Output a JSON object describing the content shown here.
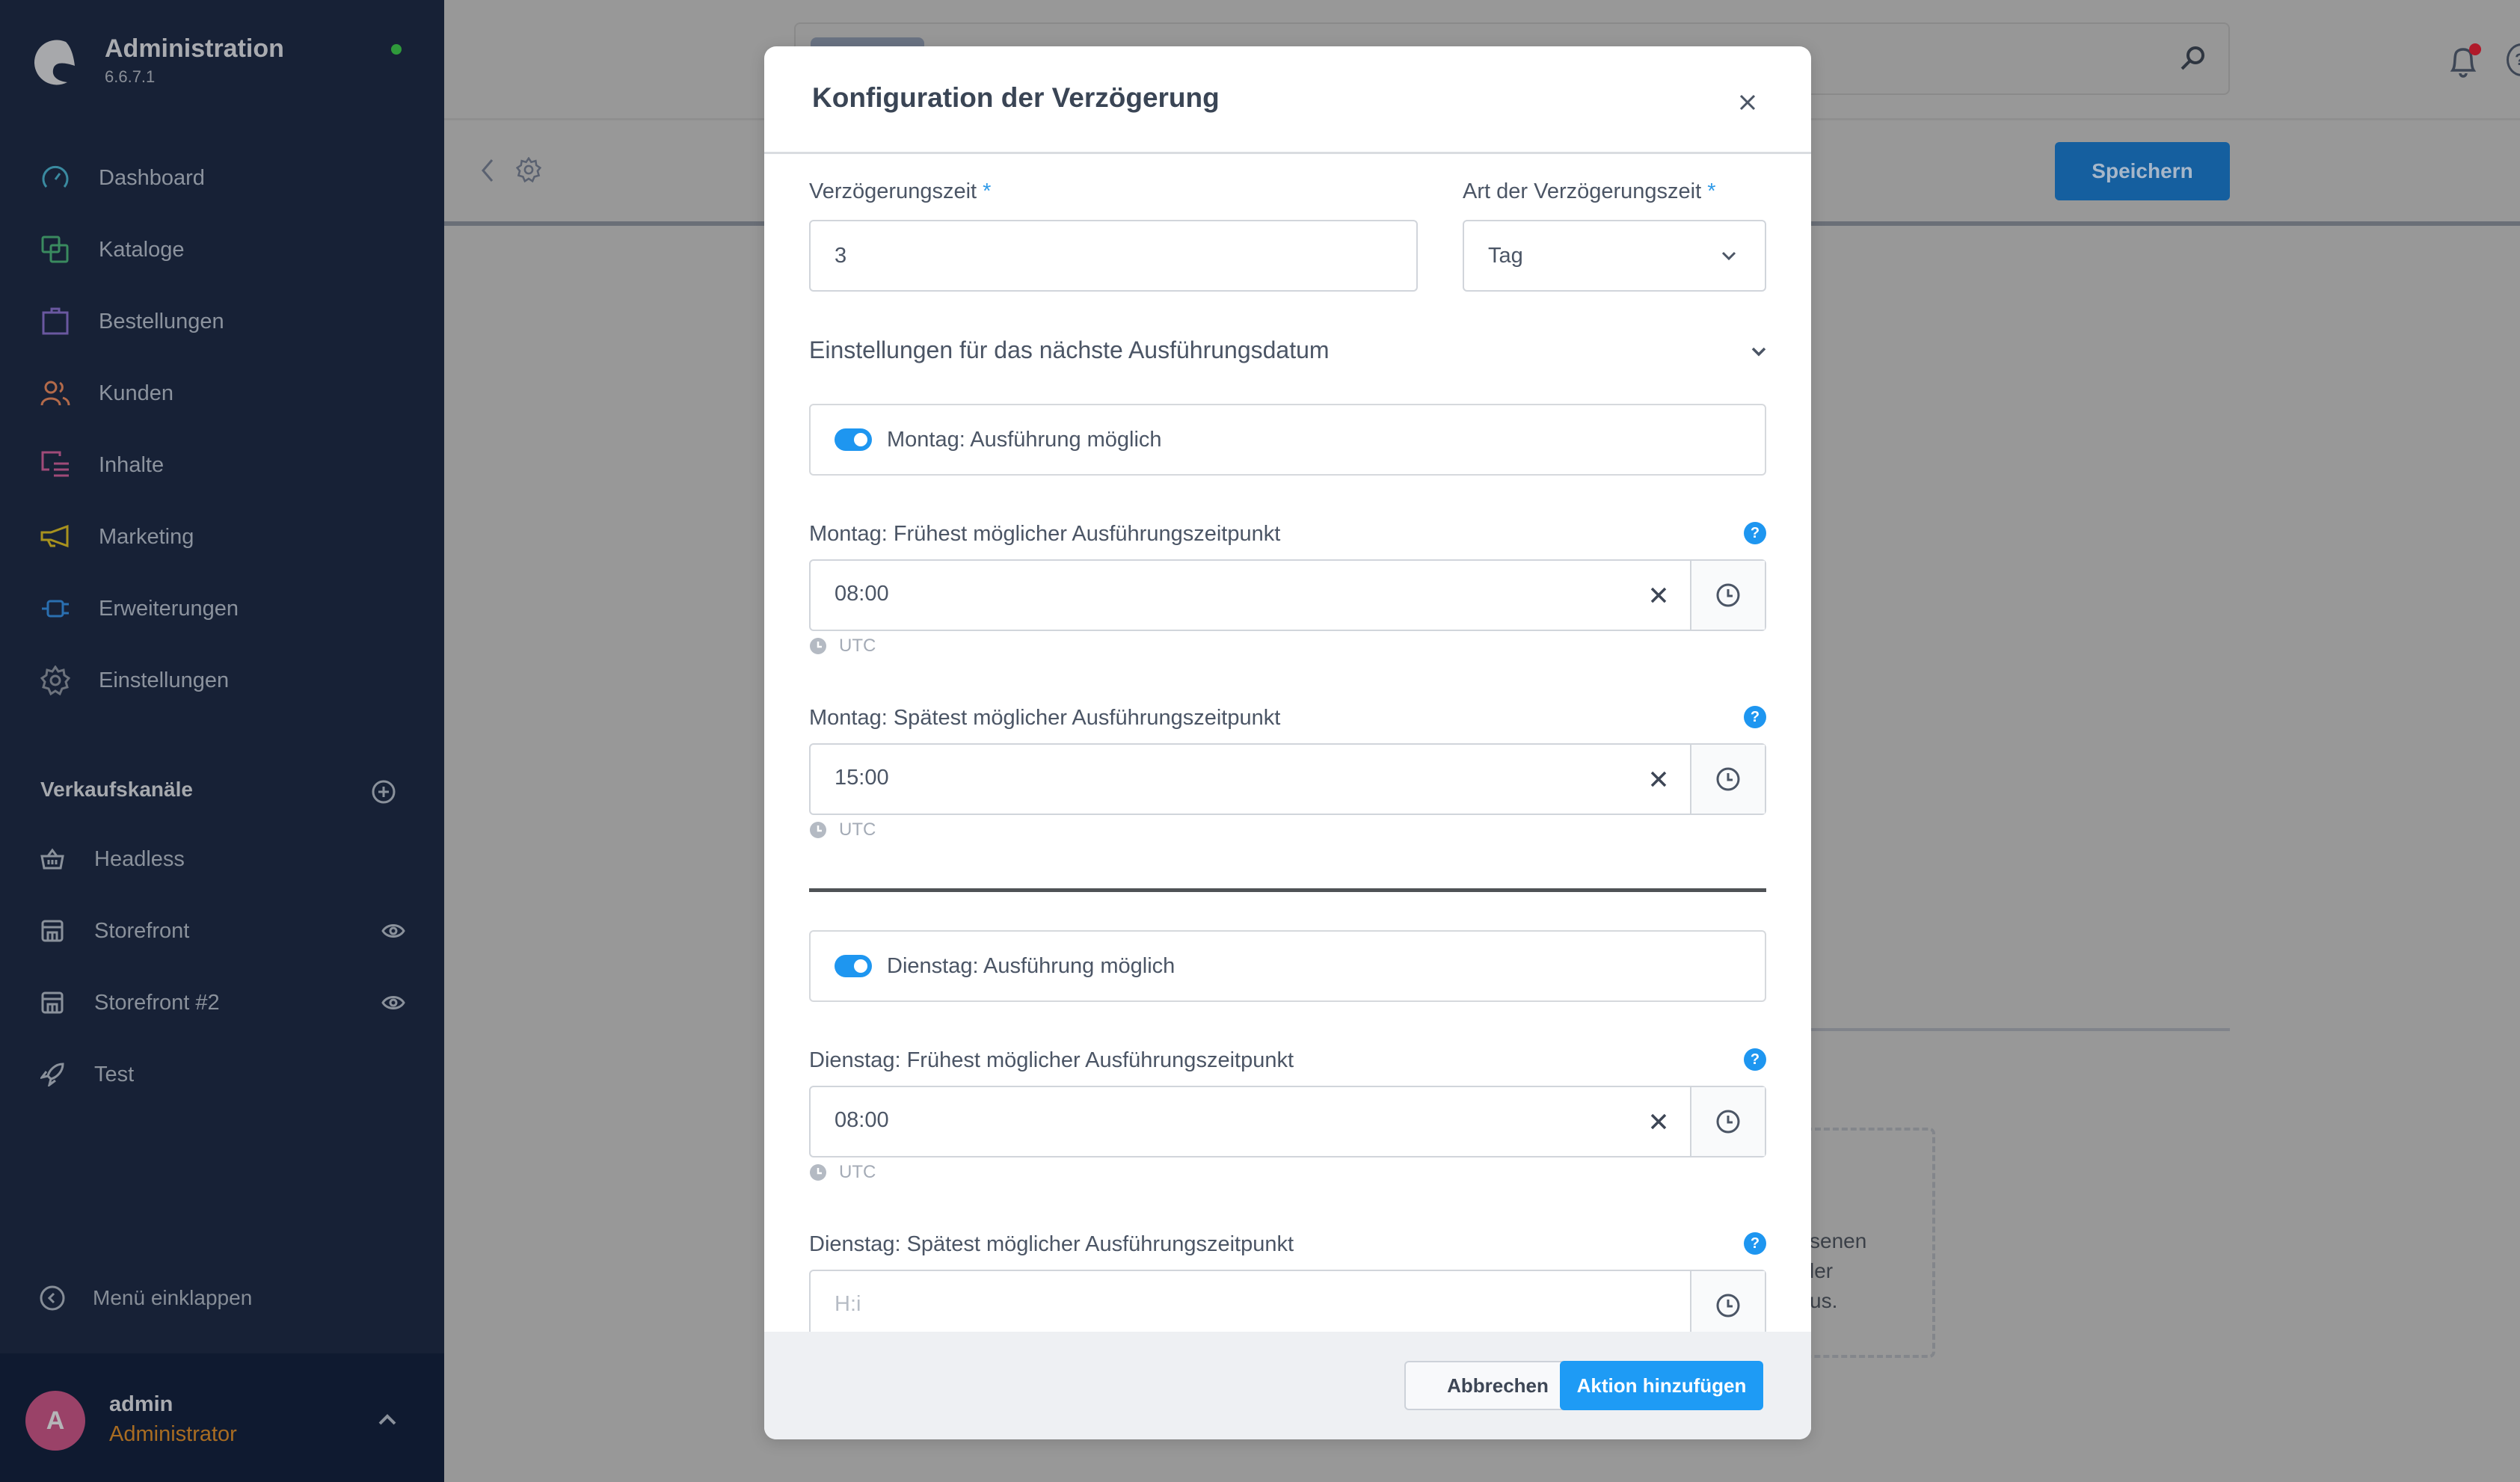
{
  "app": {
    "title": "Administration",
    "version": "6.6.7.1"
  },
  "sidebar": {
    "items": [
      {
        "label": "Dashboard",
        "icon": "dashboard-icon",
        "color": "#3a8aa0"
      },
      {
        "label": "Kataloge",
        "icon": "catalog-icon",
        "color": "#3a8a5f"
      },
      {
        "label": "Bestellungen",
        "icon": "orders-icon",
        "color": "#6a58a0"
      },
      {
        "label": "Kunden",
        "icon": "customers-icon",
        "color": "#b36a4a"
      },
      {
        "label": "Inhalte",
        "icon": "content-icon",
        "color": "#a04a78"
      },
      {
        "label": "Marketing",
        "icon": "marketing-icon",
        "color": "#a8921e"
      },
      {
        "label": "Erweiterungen",
        "icon": "extensions-icon",
        "color": "#2a6fb0"
      },
      {
        "label": "Einstellungen",
        "icon": "settings-icon",
        "color": "#6d737d"
      }
    ],
    "sales_channels_title": "Verkaufskanäle",
    "channels": [
      {
        "label": "Headless",
        "icon": "basket-icon",
        "visible_toggle": false
      },
      {
        "label": "Storefront",
        "icon": "storefront-icon",
        "visible_toggle": true
      },
      {
        "label": "Storefront #2",
        "icon": "storefront-icon",
        "visible_toggle": true
      },
      {
        "label": "Test",
        "icon": "rocket-icon",
        "visible_toggle": false
      }
    ],
    "collapse_label": "Menü einklappen",
    "user": {
      "initial": "A",
      "name": "admin",
      "role": "Administrator"
    }
  },
  "toolbar": {
    "save_label": "Speichern"
  },
  "background": {
    "dashed_text": [
      "senen",
      "ler",
      "us."
    ]
  },
  "modal": {
    "title": "Konfiguration der Verzögerung",
    "delay_time": {
      "label": "Verzögerungszeit",
      "required": "*",
      "value": "3"
    },
    "delay_type": {
      "label": "Art der Verzögerungszeit",
      "required": "*",
      "value": "Tag"
    },
    "section_title": "Einstellungen für das nächste Ausführungsdatum",
    "days": [
      {
        "switch_label": "Montag: Ausführung möglich",
        "enabled": true,
        "earliest": {
          "label": "Montag: Frühest möglicher Ausführungszeitpunkt",
          "value": "08:00",
          "timezone": "UTC"
        },
        "latest": {
          "label": "Montag: Spätest möglicher Ausführungszeitpunkt",
          "value": "15:00",
          "timezone": "UTC"
        }
      },
      {
        "switch_label": "Dienstag: Ausführung möglich",
        "enabled": true,
        "earliest": {
          "label": "Dienstag: Frühest möglicher Ausführungszeitpunkt",
          "value": "08:00",
          "timezone": "UTC"
        },
        "latest": {
          "label": "Dienstag: Spätest möglicher Ausführungszeitpunkt",
          "value": "",
          "placeholder": "H:i"
        }
      }
    ],
    "help_glyph": "?",
    "cancel_label": "Abbrechen",
    "submit_label": "Aktion hinzufügen"
  }
}
